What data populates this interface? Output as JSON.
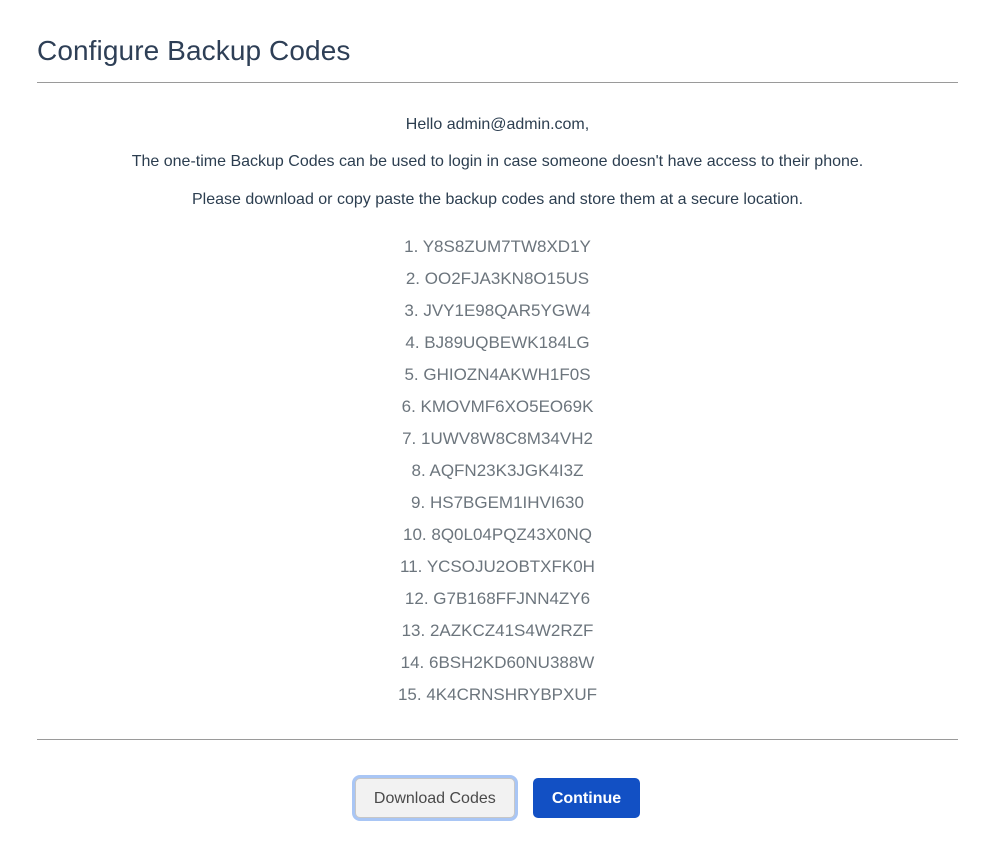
{
  "header": {
    "title": "Configure Backup Codes"
  },
  "intro": {
    "greeting": "Hello admin@admin.com,",
    "line2": "The one-time Backup Codes can be used to login in case someone doesn't have access to their phone.",
    "line3": "Please download or copy paste the backup codes and store them at a secure location."
  },
  "codes": [
    "Y8S8ZUM7TW8XD1Y",
    "OO2FJA3KN8O15US",
    "JVY1E98QAR5YGW4",
    "BJ89UQBEWK184LG",
    "GHIOZN4AKWH1F0S",
    "KMOVMF6XO5EO69K",
    "1UWV8W8C8M34VH2",
    "AQFN23K3JGK4I3Z",
    "HS7BGEM1IHVI630",
    "8Q0L04PQZ43X0NQ",
    "YCSOJU2OBTXFK0H",
    "G7B168FFJNN4ZY6",
    "2AZKCZ41S4W2RZF",
    "6BSH2KD60NU388W",
    "4K4CRNSHRYBPXUF"
  ],
  "actions": {
    "download_label": "Download Codes",
    "continue_label": "Continue"
  },
  "colors": {
    "title": "#2e3f56",
    "body_text": "#2c3e50",
    "code_text": "#6c757d",
    "primary_button": "#1250c4",
    "secondary_button": "#f2f2f2",
    "focus_ring": "#a9c6f5",
    "rule": "#9a9a9a"
  }
}
